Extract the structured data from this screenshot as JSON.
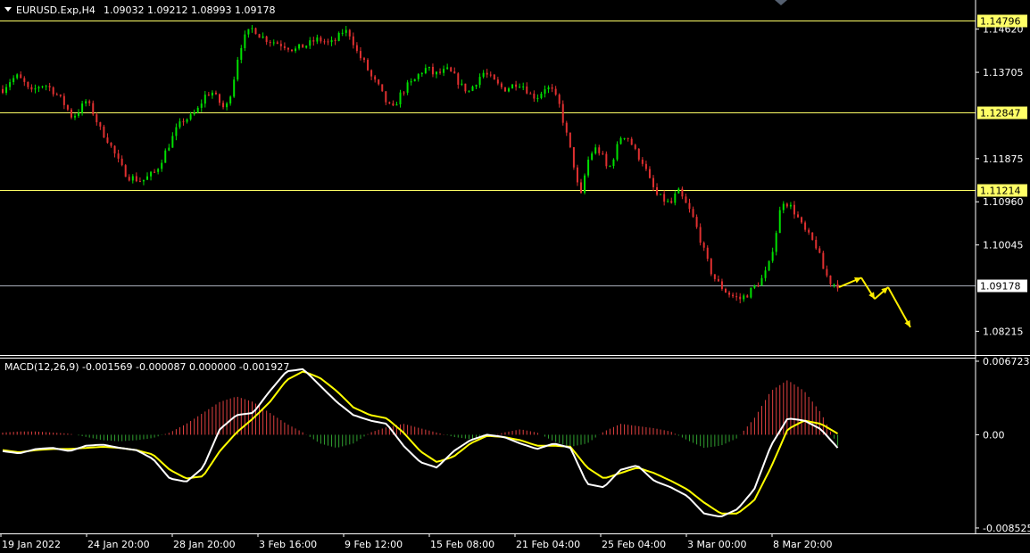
{
  "chart_data": [
    {
      "type": "candlestick",
      "header": {
        "symbol": "EURUSD.Exp,H4",
        "ohlc": "1.09032 1.09212 1.08993 1.09178"
      },
      "ylim": [
        1.0775,
        1.152
      ],
      "y_ticks": [
        "1.14620",
        "1.13705",
        "1.11875",
        "1.10960",
        "1.10045",
        "1.08215"
      ],
      "x_ticks": [
        "19 Jan 2022",
        "24 Jan 20:00",
        "28 Jan 20:00",
        "3 Feb 16:00",
        "9 Feb 12:00",
        "15 Feb 08:00",
        "21 Feb 04:00",
        "25 Feb 04:00",
        "3 Mar 00:00",
        "8 Mar 20:00"
      ],
      "levels": [
        {
          "label": "1.14796",
          "value": 1.14796,
          "color": "#ffff66"
        },
        {
          "label": "1.12847",
          "value": 1.12847,
          "color": "#ffff66"
        },
        {
          "label": "1.11214",
          "value": 1.11214,
          "color": "#ffff66"
        }
      ],
      "current_price": {
        "label": "1.09178",
        "value": 1.09178,
        "color": "#aab0bb"
      },
      "bull_color": "#00e000",
      "bear_color": "#e03030",
      "close_path": [
        1.1335,
        1.1352,
        1.1362,
        1.135,
        1.1325,
        1.134,
        1.1345,
        1.1335,
        1.132,
        1.13,
        1.1275,
        1.129,
        1.131,
        1.1285,
        1.125,
        1.123,
        1.12,
        1.117,
        1.115,
        1.1145,
        1.114,
        1.115,
        1.116,
        1.119,
        1.122,
        1.125,
        1.127,
        1.1275,
        1.129,
        1.132,
        1.133,
        1.131,
        1.129,
        1.134,
        1.142,
        1.145,
        1.1465,
        1.1448,
        1.144,
        1.1435,
        1.143,
        1.1425,
        1.1418,
        1.1425,
        1.143,
        1.144,
        1.1438,
        1.143,
        1.144,
        1.146,
        1.145,
        1.141,
        1.139,
        1.136,
        1.134,
        1.131,
        1.129,
        1.132,
        1.134,
        1.135,
        1.137,
        1.138,
        1.1365,
        1.137,
        1.1375,
        1.136,
        1.134,
        1.133,
        1.135,
        1.137,
        1.136,
        1.1345,
        1.1335,
        1.134,
        1.135,
        1.134,
        1.132,
        1.132,
        1.134,
        1.133,
        1.13,
        1.124,
        1.118,
        1.11,
        1.118,
        1.121,
        1.12,
        1.116,
        1.12,
        1.124,
        1.123,
        1.12,
        1.118,
        1.114,
        1.111,
        1.11,
        1.109,
        1.112,
        1.1095,
        1.107,
        1.103,
        1.098,
        1.094,
        1.092,
        1.0905,
        1.0895,
        1.089,
        1.09,
        1.0915,
        1.093,
        1.0955,
        1.102,
        1.11,
        1.109,
        1.107,
        1.104,
        1.102,
        1.1,
        1.095,
        1.0925,
        1.092
      ],
      "projection_arrows": [
        [
          1.0915,
          1.0935
        ],
        [
          1.0935,
          1.089
        ],
        [
          1.089,
          1.0915
        ],
        [
          1.0915,
          1.083
        ]
      ]
    },
    {
      "type": "macd",
      "label": "MACD(12,26,9) -0.001569 -0.000087 0.000000 -0.001927",
      "ylim": [
        -0.00885,
        0.0068
      ],
      "y_ticks": [
        {
          "label": "0.006723",
          "value": 0.00672
        },
        {
          "label": "0.00",
          "value": 0.0
        },
        {
          "label": "-0.008525",
          "value": -0.00852
        }
      ],
      "main_color": "#ffffff",
      "signal_color": "#ffff00",
      "hist_up_color": "#e04040",
      "hist_down_color": "#30a030",
      "main_path": [
        -0.0015,
        -0.0017,
        -0.0013,
        -0.0012,
        -0.0015,
        -0.001,
        -0.0009,
        -0.0012,
        -0.0014,
        -0.0022,
        -0.004,
        -0.0043,
        -0.003,
        0.0005,
        0.0018,
        0.002,
        0.004,
        0.0058,
        0.006,
        0.0045,
        0.003,
        0.0018,
        0.0013,
        0.001,
        -0.001,
        -0.0025,
        -0.003,
        -0.0015,
        -0.0005,
        0.0,
        -0.0002,
        -0.0008,
        -0.0013,
        -0.0008,
        -0.0012,
        -0.0045,
        -0.0048,
        -0.0032,
        -0.0028,
        -0.0042,
        -0.0048,
        -0.0056,
        -0.0072,
        -0.0075,
        -0.0068,
        -0.005,
        -0.001,
        0.0015,
        0.0013,
        0.0005,
        -0.0012
      ],
      "signal_path": [
        -0.0014,
        -0.0016,
        -0.0014,
        -0.0013,
        -0.0013,
        -0.0012,
        -0.0011,
        -0.0012,
        -0.0014,
        -0.0018,
        -0.0032,
        -0.004,
        -0.0038,
        -0.0015,
        0.0002,
        0.0015,
        0.003,
        0.005,
        0.0058,
        0.0052,
        0.004,
        0.0025,
        0.0018,
        0.0015,
        0.0002,
        -0.0015,
        -0.0025,
        -0.002,
        -0.0008,
        -0.0001,
        -0.0002,
        -0.0005,
        -0.001,
        -0.001,
        -0.0011,
        -0.003,
        -0.004,
        -0.0035,
        -0.003,
        -0.0035,
        -0.0042,
        -0.005,
        -0.0062,
        -0.0072,
        -0.0072,
        -0.006,
        -0.003,
        0.0005,
        0.0013,
        0.001,
        0.0001
      ],
      "hist_path": [
        0.0002,
        0.0003,
        0.0003,
        0.0002,
        0.0001,
        -0.0002,
        -0.0005,
        -0.0006,
        -0.0005,
        -0.0003,
        0.0002,
        0.001,
        0.002,
        0.003,
        0.0035,
        0.003,
        0.002,
        0.001,
        0.0002,
        -0.0008,
        -0.0012,
        -0.0008,
        0.0002,
        0.0007,
        0.001,
        0.0006,
        0.0002,
        -0.0002,
        -0.0004,
        -0.0002,
        0.0002,
        0.0005,
        0.0002,
        -0.0006,
        -0.0011,
        -0.0008,
        0.0003,
        0.001,
        0.0008,
        0.0006,
        0.0003,
        -0.0005,
        -0.0012,
        -0.001,
        -0.0003,
        0.0015,
        0.004,
        0.005,
        0.004,
        0.002,
        -0.001
      ]
    }
  ]
}
